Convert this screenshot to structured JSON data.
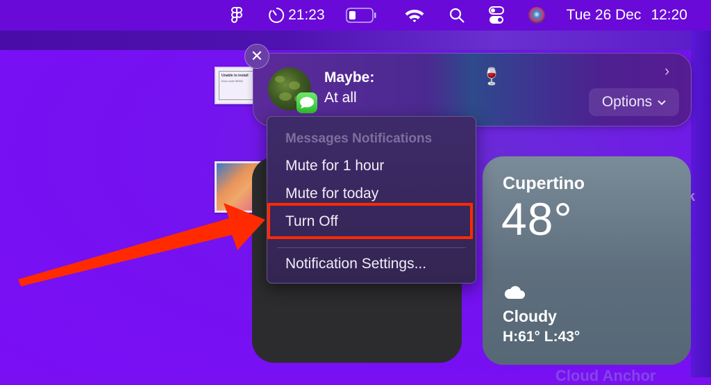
{
  "menubar": {
    "items": [
      {
        "icon": "figma-icon"
      },
      {
        "icon": "timer-icon",
        "label": "21:23"
      },
      {
        "icon": "battery-icon",
        "level_percent": 30
      },
      {
        "icon": "wifi-icon"
      },
      {
        "icon": "search-icon"
      },
      {
        "icon": "control-center-icon"
      },
      {
        "icon": "siri-icon"
      }
    ],
    "date": "Tue 26 Dec",
    "time": "12:20"
  },
  "desktop": {
    "thumbnail_1": {
      "title": "Unable to install",
      "subtitle": "Error code 50002"
    },
    "bg_text_right": "k",
    "bg_text_bottom": "Cloud Anchor"
  },
  "notification": {
    "close_symbol": "✕",
    "sender_label": "Maybe:",
    "message": "At all",
    "emoji": "🍷",
    "expand_symbol": "›",
    "options_label": "Options",
    "options_chevron": "⌄",
    "app_icon": "messages-icon"
  },
  "context_menu": {
    "header": "Messages Notifications",
    "items": [
      {
        "label": "Mute for 1 hour"
      },
      {
        "label": "Mute for today"
      },
      {
        "label": "Turn Off",
        "highlighted": true
      },
      {
        "label": "Notification Settings..."
      }
    ]
  },
  "weather_widget": {
    "city": "Cupertino",
    "temperature": "48°",
    "condition": "Cloudy",
    "high_low": "H:61° L:43°",
    "icon": "cloud-icon"
  },
  "annotation": {
    "highlight_color": "#ff2a00",
    "arrow_color": "#ff2a00"
  }
}
